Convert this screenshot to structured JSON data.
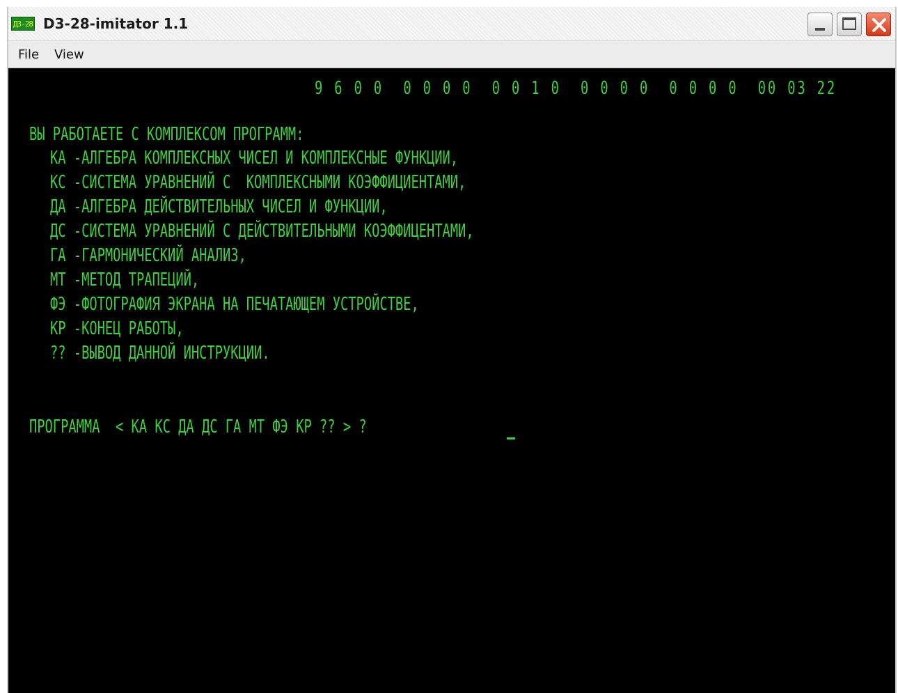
{
  "window": {
    "title": "D3-28-imitator 1.1",
    "icon_text": "Д3-28"
  },
  "menubar": {
    "file": "File",
    "view": "View"
  },
  "terminal": {
    "status": "9 6 0 0  0 0 0 0  0 0 1 0  0 0 0 0  0 0 0 0  00 03 22",
    "header": "ВЫ РАБОТАЕТЕ С КОМПЛЕКСОМ ПРОГРАММ:",
    "items": [
      "КА -АЛГЕБРА КОМПЛЕКСНЫХ ЧИСЕЛ И КОМПЛЕКСНЫЕ ФУНКЦИИ,",
      "КС -СИСТЕМА УРАВНЕНИЙ С  КОМПЛЕКСНЫМИ КОЭФФИЦИЕНТАМИ,",
      "ДА -АЛГЕБРА ДЕЙСТВИТЕЛЬНЫХ ЧИСЕЛ И ФУНКЦИИ,",
      "ДС -СИСТЕМА УРАВНЕНИЙ С ДЕЙСТВИТЕЛЬНЫМИ КОЭФФИЦЕНТАМИ,",
      "ГА -ГАРМОНИЧЕСКИЙ АНАЛИЗ,",
      "МТ -МЕТОД ТРАПЕЦИЙ,",
      "ФЭ -ФОТОГРАФИЯ ЭКРАНА НА ПЕЧАТАЮЩЕМ УСТРОЙСТВЕ,",
      "КР -КОНЕЦ РАБОТЫ,",
      "?? -ВЫВОД ДАННОЙ ИНСТРУКЦИИ."
    ],
    "prompt": "ПРОГРАММА  < КА КС ДА ДС ГА МТ ФЭ КР ?? > ?"
  },
  "colors": {
    "terminal_text": "#3fcf3f",
    "terminal_bg": "#000000",
    "close_button": "#d6371b"
  }
}
